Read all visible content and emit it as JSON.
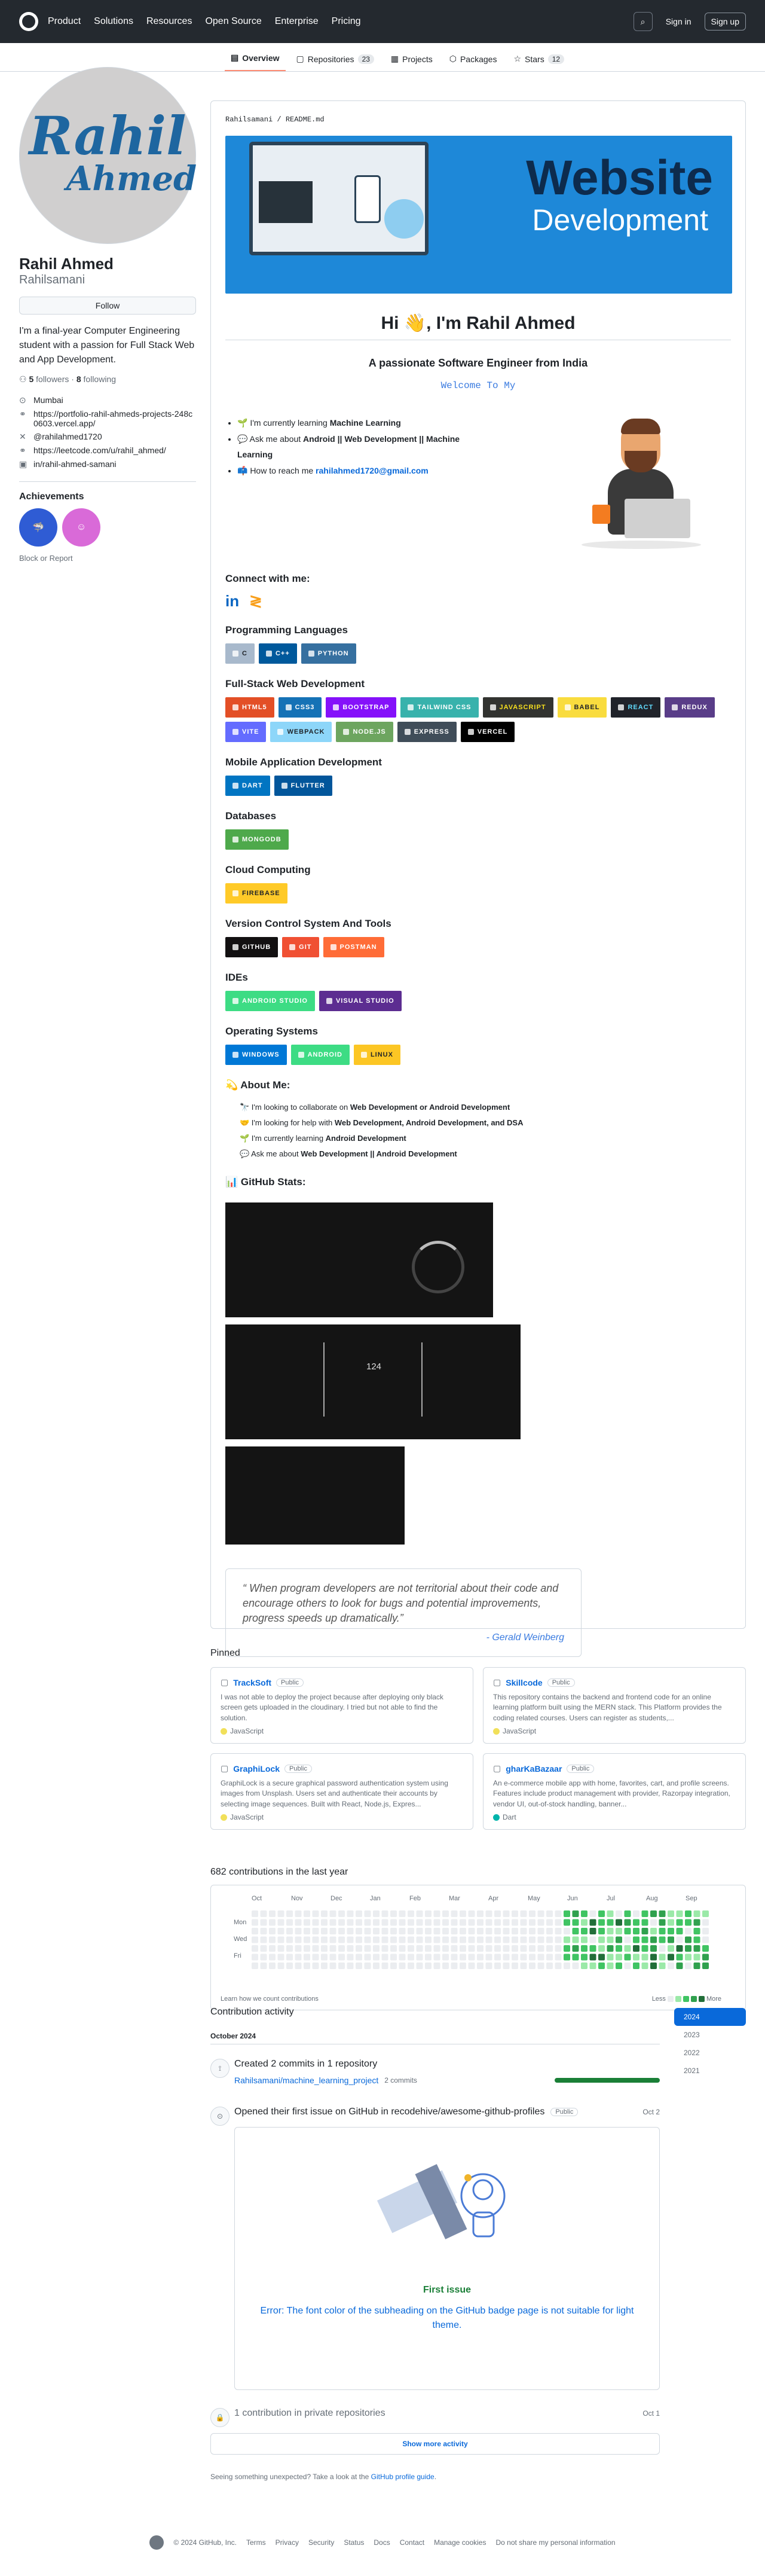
{
  "nav": {
    "items": [
      "Product",
      "Solutions",
      "Resources",
      "Open Source",
      "Enterprise",
      "Pricing"
    ],
    "signin": "Sign in",
    "signup": "Sign up"
  },
  "tabs": [
    {
      "label": "Overview",
      "count": ""
    },
    {
      "label": "Repositories",
      "count": "23"
    },
    {
      "label": "Projects",
      "count": ""
    },
    {
      "label": "Packages",
      "count": ""
    },
    {
      "label": "Stars",
      "count": "12"
    }
  ],
  "profile": {
    "avatar_line1": "Rahil",
    "avatar_line2": "Ahmed",
    "name": "Rahil Ahmed",
    "login": "Rahilsamani",
    "follow": "Follow",
    "bio": "I'm a final-year Computer Engineering student with a passion for Full Stack Web and App Development.",
    "followers": "5",
    "followers_label": "followers",
    "following": "8",
    "following_label": "following",
    "location": "Mumbai",
    "website": "https://portfolio-rahil-ahmeds-projects-248c0603.vercel.app/",
    "twitter": "@rahilahmed1720",
    "leetcode": "https://leetcode.com/u/rahil_ahmed/",
    "linkedin": "in/rahil-ahmed-samani",
    "achievements_title": "Achievements",
    "block": "Block or Report"
  },
  "readme": {
    "path": "Rahilsamani / README.md",
    "banner_word1": "Website",
    "banner_word2": "Development",
    "hi": "Hi 👋, I'm Rahil Ahmed",
    "subtitle": "A passionate Software Engineer from India",
    "typing": "Welcome To My",
    "intro": [
      {
        "pre": "🌱 I'm currently learning ",
        "bold": "Machine Learning"
      },
      {
        "pre": "💬 Ask me about ",
        "bold": "Android || Web Development || Machine Learning"
      },
      {
        "pre": "📫 How to reach me ",
        "link": "rahilahmed1720@gmail.com"
      }
    ],
    "connect": "Connect with me:",
    "sections": [
      {
        "title": "Programming Languages",
        "shields": [
          {
            "label": "C",
            "color": "#a8b9cc",
            "dark": true
          },
          {
            "label": "C++",
            "color": "#00599c"
          },
          {
            "label": "PYTHON",
            "color": "#3670a0"
          }
        ]
      },
      {
        "title": "Full-Stack Web Development",
        "shields": [
          {
            "label": "HTML5",
            "color": "#e34f26"
          },
          {
            "label": "CSS3",
            "color": "#1572b6"
          },
          {
            "label": "BOOTSTRAP",
            "color": "#8511fa"
          },
          {
            "label": "TAILWIND CSS",
            "color": "#38b2ac"
          },
          {
            "label": "JAVASCRIPT",
            "color": "#323330",
            "text": "#f7df1e"
          },
          {
            "label": "BABEL",
            "color": "#f9dc3e",
            "dark": true
          },
          {
            "label": "REACT",
            "color": "#20232a",
            "text": "#61dafb"
          },
          {
            "label": "REDUX",
            "color": "#593d88"
          },
          {
            "label": "VITE",
            "color": "#646cff"
          },
          {
            "label": "WEBPACK",
            "color": "#8dd6f9",
            "dark": true
          },
          {
            "label": "NODE.JS",
            "color": "#6da55f"
          },
          {
            "label": "EXPRESS",
            "color": "#404d59"
          },
          {
            "label": "VERCEL",
            "color": "#000000"
          }
        ]
      },
      {
        "title": "Mobile Application Development",
        "shields": [
          {
            "label": "DART",
            "color": "#0175c2"
          },
          {
            "label": "FLUTTER",
            "color": "#02569b"
          }
        ]
      },
      {
        "title": "Databases",
        "shields": [
          {
            "label": "MONGODB",
            "color": "#4ea94b"
          }
        ]
      },
      {
        "title": "Cloud Computing",
        "shields": [
          {
            "label": "FIREBASE",
            "color": "#ffca28",
            "dark": true
          }
        ]
      },
      {
        "title": "Version Control System And Tools",
        "shields": [
          {
            "label": "GITHUB",
            "color": "#121011"
          },
          {
            "label": "GIT",
            "color": "#f05033"
          },
          {
            "label": "POSTMAN",
            "color": "#ff6c37"
          }
        ]
      },
      {
        "title": "IDEs",
        "shields": [
          {
            "label": "ANDROID STUDIO",
            "color": "#3ddc84"
          },
          {
            "label": "VISUAL STUDIO",
            "color": "#5c2d91"
          }
        ]
      },
      {
        "title": "Operating Systems",
        "shields": [
          {
            "label": "WINDOWS",
            "color": "#0078d6"
          },
          {
            "label": "ANDROID",
            "color": "#3ddc84"
          },
          {
            "label": "LINUX",
            "color": "#fcc624",
            "dark": true
          }
        ]
      }
    ],
    "about_title": "💫 About Me:",
    "about": [
      {
        "pre": "🔭 I'm looking to collaborate on ",
        "bold": "Web Development or Android Development"
      },
      {
        "pre": "🤝 I'm looking for help with ",
        "bold": "Web Development, Android Development, and DSA"
      },
      {
        "pre": "🌱 I'm currently learning ",
        "bold": "Android Development"
      },
      {
        "pre": "💬 Ask me about ",
        "bold": "Web Development || Android Development"
      }
    ],
    "stats_title": "📊 GitHub Stats:",
    "streak_value": "124",
    "quote": "“ When program developers are not territorial about their code and encourage others to look for bugs and potential improvements, progress speeds up dramatically.”",
    "quote_author": "- Gerald Weinberg"
  },
  "pinned": {
    "title": "Pinned",
    "cards": [
      {
        "name": "TrackSoft",
        "badge": "Public",
        "desc": "I was not able to deploy the project because after deploying only black screen gets uploaded in the cloudinary. I tried but not able to find the solution.",
        "lang": "JavaScript",
        "lang_color": "#f1e05a"
      },
      {
        "name": "Skillcode",
        "badge": "Public",
        "desc": "This repository contains the backend and frontend code for an online learning platform built using the MERN stack. This Platform provides the coding related courses. Users can register as students,...",
        "lang": "JavaScript",
        "lang_color": "#f1e05a"
      },
      {
        "name": "GraphiLock",
        "badge": "Public",
        "desc": "GraphiLock is a secure graphical password authentication system using images from Unsplash. Users set and authenticate their accounts by selecting image sequences. Built with React, Node.js, Expres...",
        "lang": "JavaScript",
        "lang_color": "#f1e05a"
      },
      {
        "name": "gharKaBazaar",
        "badge": "Public",
        "desc": "An e-commerce mobile app with home, favorites, cart, and profile screens. Features include product management with provider, Razorpay integration, vendor UI, out-of-stock handling, banner...",
        "lang": "Dart",
        "lang_color": "#00b4ab"
      }
    ]
  },
  "contributions": {
    "title": "682 contributions in the last year",
    "months": [
      "Oct",
      "Nov",
      "Dec",
      "Jan",
      "Feb",
      "Mar",
      "Apr",
      "May",
      "Jun",
      "Jul",
      "Aug",
      "Sep"
    ],
    "days": [
      "Mon",
      "Wed",
      "Fri"
    ],
    "learn": "Learn how we count contributions",
    "less": "Less",
    "more": "More",
    "level_colors": [
      "#ebedf0",
      "#9be9a8",
      "#40c463",
      "#30a14e",
      "#216e39"
    ]
  },
  "activity": {
    "title": "Contribution activity",
    "month": "October 2024",
    "years": [
      "2024",
      "2023",
      "2022",
      "2021"
    ],
    "event1_title": "Created 2 commits in 1 repository",
    "event1_repo": "Rahilsamani/machine_learning_project",
    "event1_commits": "2 commits",
    "event2_title": "Opened their first issue on GitHub in recodehive/awesome-github-profiles",
    "event2_badge": "Public",
    "event2_date": "Oct 2",
    "issue_label": "First issue",
    "issue_title": "Error: The font color of the subheading on the GitHub badge page is not suitable for light theme.",
    "event3_title": "1 contribution in private repositories",
    "event3_date": "Oct 1",
    "show_more": "Show more activity",
    "unexpected": "Seeing something unexpected? Take a look at the",
    "guide": "GitHub profile guide",
    "guide_end": "."
  },
  "footer": {
    "links": [
      "© 2024 GitHub, Inc.",
      "Terms",
      "Privacy",
      "Security",
      "Status",
      "Docs",
      "Contact",
      "Manage cookies",
      "Do not share my personal information"
    ]
  }
}
